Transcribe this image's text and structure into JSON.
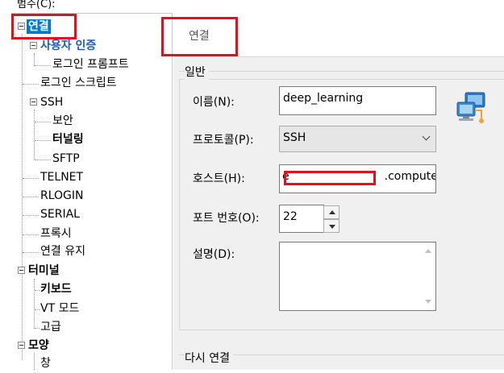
{
  "category_label": "범주(C):",
  "tree": {
    "items": [
      {
        "label": "연결"
      },
      {
        "label": "사용자 인증"
      },
      {
        "label": "로그인 프롬프트"
      },
      {
        "label": "로그인 스크립트"
      },
      {
        "label": "SSH"
      },
      {
        "label": "보안"
      },
      {
        "label": "터널링"
      },
      {
        "label": "SFTP"
      },
      {
        "label": "TELNET"
      },
      {
        "label": "RLOGIN"
      },
      {
        "label": "SERIAL"
      },
      {
        "label": "프록시"
      },
      {
        "label": "연결 유지"
      },
      {
        "label": "터미널"
      },
      {
        "label": "키보드"
      },
      {
        "label": "VT 모드"
      },
      {
        "label": "고급"
      },
      {
        "label": "모양"
      },
      {
        "label": "창"
      }
    ]
  },
  "panel": {
    "title": "연결",
    "general_group": "일반",
    "name_label": "이름(N):",
    "name_value": "deep_learning",
    "protocol_label": "프로토콜(P):",
    "protocol_value": "SSH",
    "host_label": "호스트(H):",
    "host_value_prefix": "e",
    "host_value_suffix": ".compute-",
    "port_label": "포트 번호(O):",
    "port_value": "22",
    "description_label": "설명(D):",
    "reconnect_group": "다시 연결"
  },
  "colors": {
    "selection": "#0078d7",
    "highlight_box": "#e0101e",
    "link": "#1a5cc8"
  }
}
